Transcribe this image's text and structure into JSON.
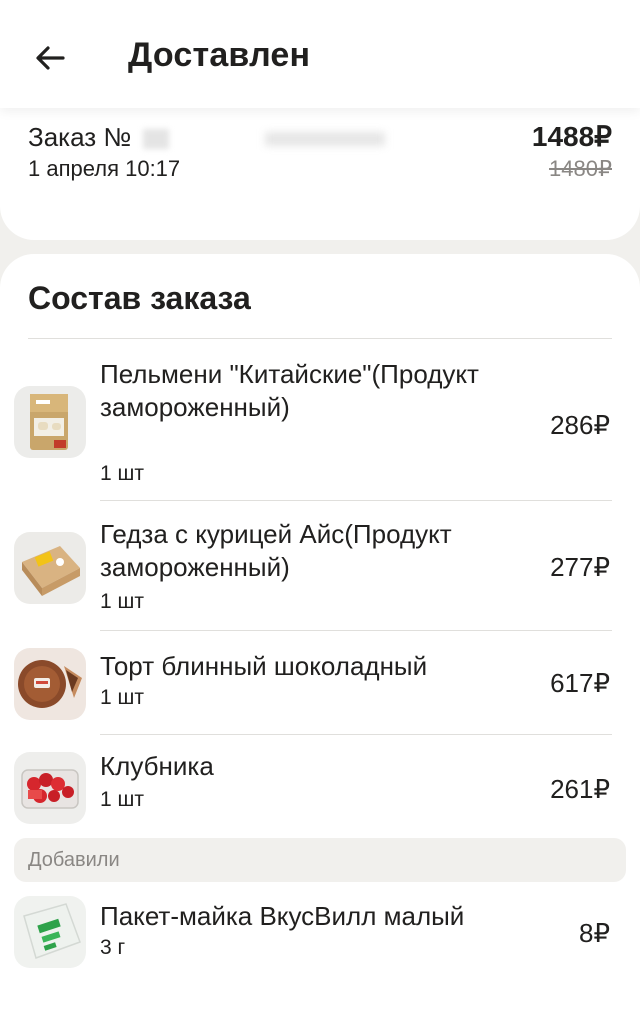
{
  "header": {
    "title": "Доставлен",
    "back_icon": "arrow-left-icon"
  },
  "summary": {
    "order_label": "Заказ №",
    "date": "1 апреля 10:17",
    "total": "1488₽",
    "old_total": "1480₽"
  },
  "composition": {
    "title": "Состав заказа",
    "items": [
      {
        "name": "Пельмени \"Китайские\"(Продукт замороженный)",
        "qty": "1 шт",
        "price": "286₽"
      },
      {
        "name": "Гедза с курицей Айс(Продукт замороженный)",
        "qty": "1 шт",
        "price": "277₽"
      },
      {
        "name": "Торт блинный шоколадный",
        "qty": "1 шт",
        "price": "617₽"
      },
      {
        "name": "Клубника",
        "qty": "1 шт",
        "price": "261₽"
      }
    ],
    "added_label": "Добавили",
    "added_items": [
      {
        "name": "Пакет-майка ВкусВилл малый",
        "qty": "3 г",
        "price": "8₽"
      }
    ]
  }
}
